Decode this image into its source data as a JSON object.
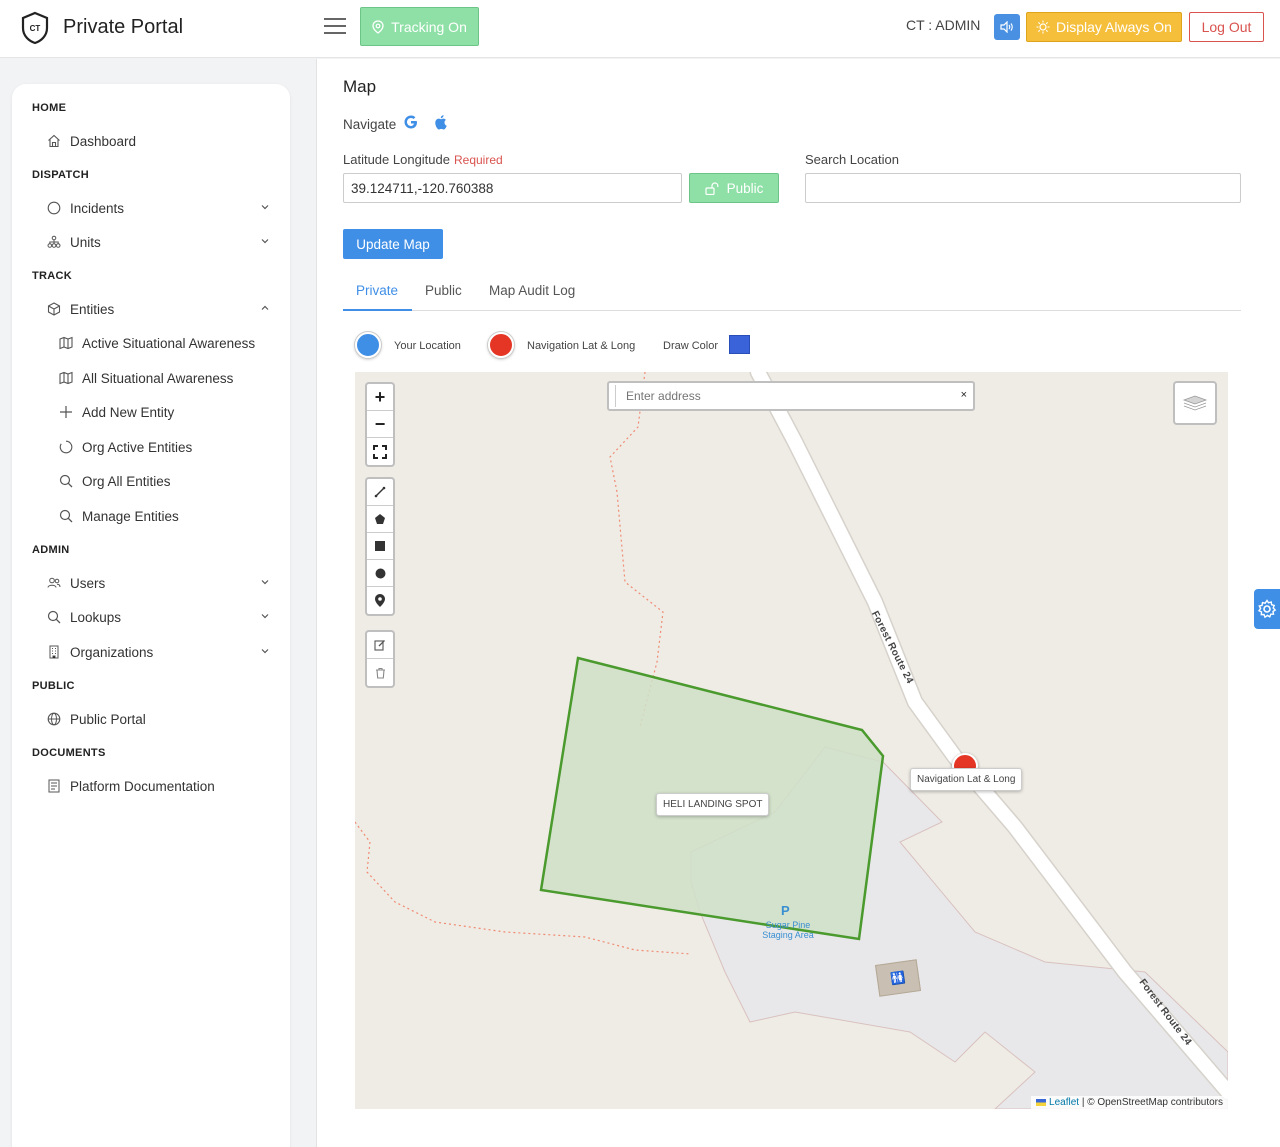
{
  "app": {
    "brand": "Private Portal",
    "logo_text": "CT",
    "tracking_label": "Tracking On",
    "user_label": "CT : ADMIN",
    "display_label": "Display Always On",
    "logout_label": "Log Out"
  },
  "sidebar": {
    "sections": {
      "home": "HOME",
      "dispatch": "DISPATCH",
      "track": "TRACK",
      "admin": "ADMIN",
      "public": "PUBLIC",
      "documents": "DOCUMENTS"
    },
    "items": {
      "dashboard": "Dashboard",
      "incidents": "Incidents",
      "units": "Units",
      "entities": "Entities",
      "active_sa": "Active Situational Awareness",
      "all_sa": "All Situational Awareness",
      "add_entity": "Add New Entity",
      "org_active": "Org Active Entities",
      "org_all": "Org All Entities",
      "manage": "Manage Entities",
      "users": "Users",
      "lookups": "Lookups",
      "organizations": "Organizations",
      "public_portal": "Public Portal",
      "platform_docs": "Platform Documentation"
    }
  },
  "main": {
    "title": "Map",
    "navigate_label": "Navigate",
    "latlng_label": "Latitude Longitude",
    "required_label": "Required",
    "latlng_value": "39.124711,-120.760388",
    "public_button": "Public",
    "search_label": "Search Location",
    "search_value": "",
    "update_button": "Update Map",
    "tabs": {
      "private": "Private",
      "public": "Public",
      "audit": "Map Audit Log"
    },
    "legend": {
      "your_location": "Your Location",
      "navigation": "Navigation Lat & Long",
      "draw_color": "Draw Color"
    },
    "colors": {
      "your_location": "#3f8fe6",
      "navigation": "#e53525",
      "draw_color": "#3a62d9",
      "polygon_stroke": "#4a9a2e"
    }
  },
  "map": {
    "address_placeholder": "Enter address",
    "clear_label": "×",
    "polygon_label": "HELI LANDING SPOT",
    "marker_label": "Navigation Lat & Long",
    "road_label": "Forest Route 24",
    "poi_symbol": "P",
    "poi_label": "Sugar Pine Staging Area",
    "attribution_link": "Leaflet",
    "attribution_text": "| © OpenStreetMap contributors"
  }
}
